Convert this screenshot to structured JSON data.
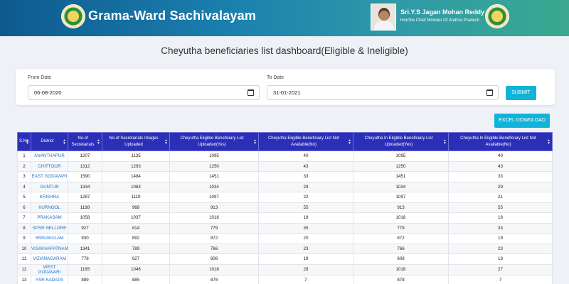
{
  "header": {
    "app_title": "Grama-Ward Sachivalayam",
    "cm_name": "Sri.Y.S Jagan Mohan Reddy",
    "cm_subtitle": "Hon'ble Chief Minister Of Andhra Pradesh"
  },
  "page_title": "Cheyutha beneficiaries list dashboard(Eligible & Ineligible)",
  "filters": {
    "from_label": "From Date",
    "from_value": "06-08-2020",
    "to_label": "To Date",
    "to_value": "31-01-2021",
    "submit_label": "SUBMIT"
  },
  "excel_label": "EXCEL DOWNLOAD",
  "colors": {
    "header_table": "#2b2fb8",
    "button": "#12b3d9",
    "link": "#1a73c9"
  },
  "table": {
    "headers": [
      "S.No",
      "District",
      "No.of Secretariats",
      "No.of Secretariats Images Uploaded",
      "Cheyutha Eligible Beneficiary List Uploaded(Yes)",
      "Cheyutha Eligible Beneficiary List Not Available(No)",
      "Cheyutha In Eligible Beneficiary List Uploaded(Yes)",
      "Cheyutha In Eligible Beneficiary List Not Available(No)"
    ],
    "rows": [
      [
        "1",
        "ANANTHAPUR",
        "1207",
        "1135",
        "1095",
        "40",
        "1095",
        "40"
      ],
      [
        "2",
        "CHITTOOR",
        "1312",
        "1293",
        "1250",
        "43",
        "1250",
        "43"
      ],
      [
        "3",
        "EAST GODAVARI",
        "1590",
        "1484",
        "1451",
        "33",
        "1451",
        "33"
      ],
      [
        "4",
        "GUNTUR",
        "1334",
        "1063",
        "1034",
        "29",
        "1034",
        "29"
      ],
      [
        "5",
        "KRISHNA",
        "1287",
        "1119",
        "1097",
        "22",
        "1097",
        "21"
      ],
      [
        "6",
        "KURNOOL",
        "1188",
        "968",
        "913",
        "55",
        "913",
        "55"
      ],
      [
        "7",
        "PRAKASAM",
        "1058",
        "1037",
        "1018",
        "19",
        "1018",
        "16"
      ],
      [
        "8",
        "SPSR NELLORE",
        "927",
        "814",
        "779",
        "35",
        "779",
        "33"
      ],
      [
        "9",
        "SRIKAKULAM",
        "930",
        "892",
        "872",
        "20",
        "872",
        "19"
      ],
      [
        "10",
        "VISAKHAPATNAM",
        "1341",
        "789",
        "766",
        "23",
        "766",
        "23"
      ],
      [
        "11",
        "VIZIANAGARAM",
        "778",
        "627",
        "608",
        "19",
        "608",
        "18"
      ],
      [
        "12",
        "WEST GODAVARI",
        "1165",
        "1046",
        "1018",
        "28",
        "1018",
        "27"
      ],
      [
        "13",
        "YSR KADAPA",
        "889",
        "885",
        "878",
        "7",
        "878",
        "7"
      ]
    ]
  }
}
